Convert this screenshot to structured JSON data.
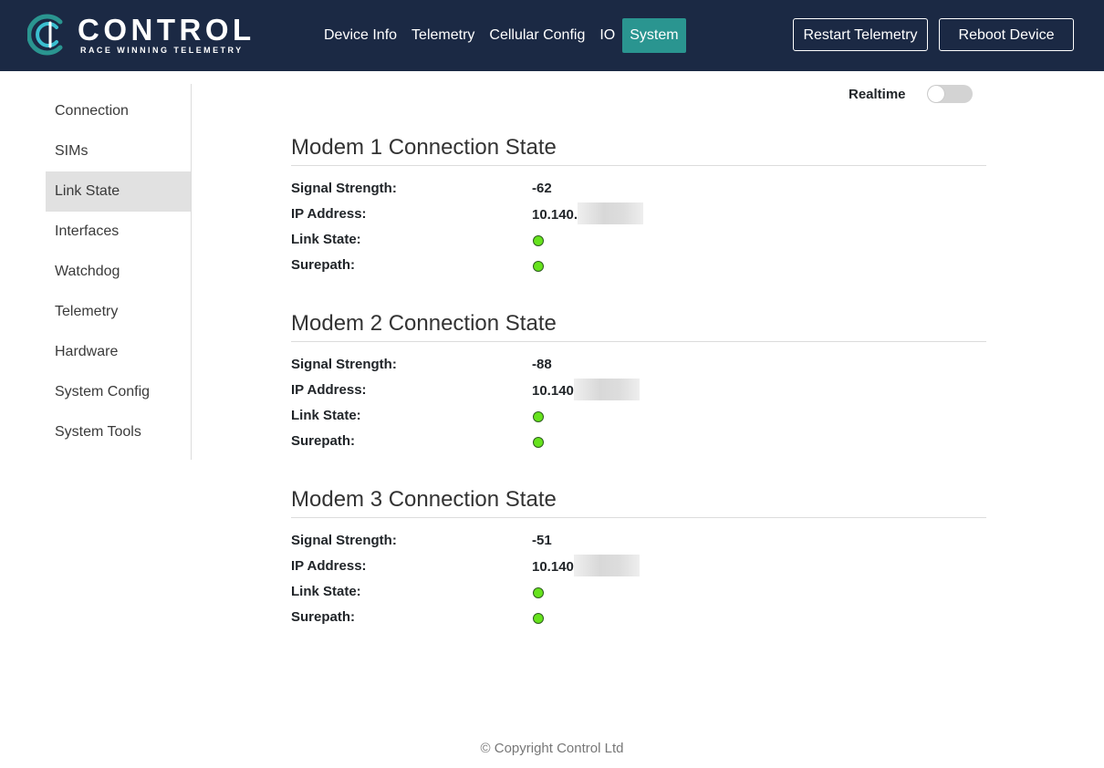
{
  "brand": {
    "name": "CONTROL",
    "tagline": "RACE WINNING TELEMETRY",
    "logo_icon": "control-c-logo-icon",
    "colors": {
      "nav_bg": "#1b2944",
      "accent": "#2a9590",
      "led_ok": "#66e31d"
    }
  },
  "nav": {
    "items": [
      {
        "label": "Device Info",
        "active": false
      },
      {
        "label": "Telemetry",
        "active": false
      },
      {
        "label": "Cellular Config",
        "active": false
      },
      {
        "label": "IO",
        "active": false
      },
      {
        "label": "System",
        "active": true
      }
    ],
    "restart_label": "Restart Telemetry",
    "reboot_label": "Reboot Device"
  },
  "sidebar": {
    "items": [
      {
        "label": "Connection",
        "active": false
      },
      {
        "label": "SIMs",
        "active": false
      },
      {
        "label": "Link State",
        "active": true
      },
      {
        "label": "Interfaces",
        "active": false
      },
      {
        "label": "Watchdog",
        "active": false
      },
      {
        "label": "Telemetry",
        "active": false
      },
      {
        "label": "Hardware",
        "active": false
      },
      {
        "label": "System Config",
        "active": false
      },
      {
        "label": "System Tools",
        "active": false
      }
    ]
  },
  "realtime": {
    "label": "Realtime",
    "enabled": false
  },
  "labels": {
    "signal": "Signal Strength:",
    "ip": "IP Address:",
    "link": "Link State:",
    "surepath": "Surepath:"
  },
  "modems": [
    {
      "title": "Modem 1 Connection State",
      "signal": "-62",
      "ip_visible": "10.140.",
      "link_ok": true,
      "surepath_ok": true
    },
    {
      "title": "Modem 2 Connection State",
      "signal": "-88",
      "ip_visible": "10.140",
      "link_ok": true,
      "surepath_ok": true
    },
    {
      "title": "Modem 3 Connection State",
      "signal": "-51",
      "ip_visible": "10.140",
      "link_ok": true,
      "surepath_ok": true
    }
  ],
  "footer": {
    "copyright": "© Copyright Control Ltd"
  }
}
